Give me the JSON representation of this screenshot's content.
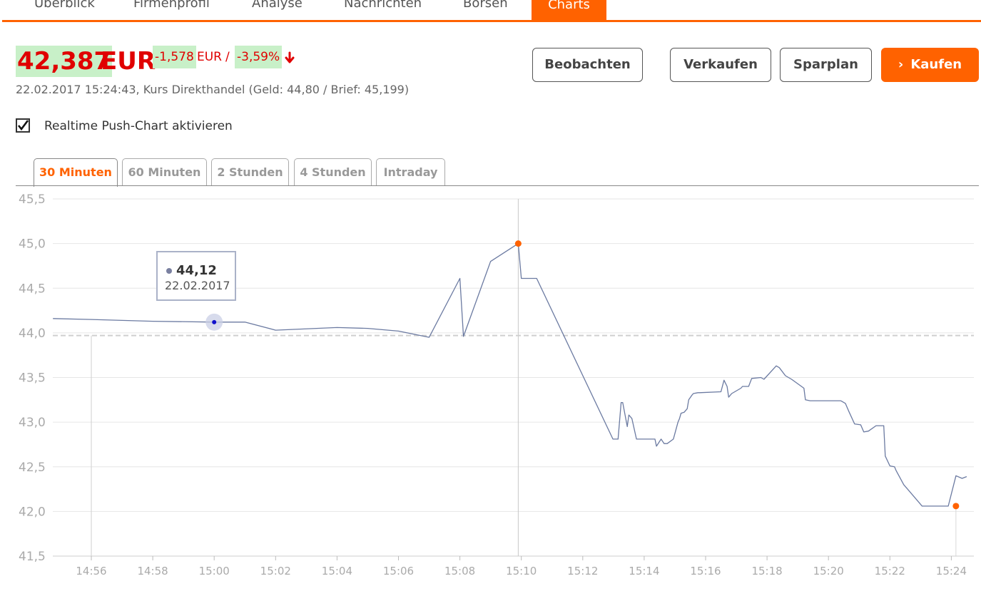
{
  "nav": {
    "items": [
      "Überblick",
      "Firmenprofil",
      "Analyse",
      "Nachrichten",
      "Börsen",
      "Charts"
    ],
    "active": "Charts"
  },
  "quote": {
    "price": "42,387",
    "currency": "EUR",
    "change_abs": "-1,578",
    "change_unit": "EUR",
    "separator": "/",
    "change_pct": "-3,59%",
    "trend_icon": "down-arrow-icon",
    "subline": "22.02.2017 15:24:43, Kurs Direkthandel (Geld: 44,80 / Brief: 45,199)"
  },
  "actions": {
    "watch": "Beobachten",
    "sell": "Verkaufen",
    "savings": "Sparplan",
    "buy": "Kaufen",
    "buy_icon": "chevron-right-icon"
  },
  "realtime": {
    "label": "Realtime Push-Chart aktivieren",
    "checked": true
  },
  "tabs": [
    "30 Minuten",
    "60 Minuten",
    "2 Stunden",
    "4 Stunden",
    "Intraday"
  ],
  "active_tab": "30 Minuten",
  "tooltip": {
    "value": "44,12",
    "date": "22.02.2017"
  },
  "colors": {
    "accent": "#ff6200",
    "negative": "#e00000",
    "highlight": "#c8f0c8",
    "line": "#6b7aa1"
  },
  "chart_data": {
    "type": "line",
    "ylim": [
      41.5,
      45.5
    ],
    "y_ticks": [
      "45,5",
      "45,0",
      "44,5",
      "44,0",
      "43,5",
      "43,0",
      "42,5",
      "42,0",
      "41,5"
    ],
    "x_ticks": [
      "14:56",
      "14:58",
      "15:00",
      "15:02",
      "15:04",
      "15:06",
      "15:08",
      "15:10",
      "15:12",
      "15:14",
      "15:16",
      "15:18",
      "15:20",
      "15:22",
      "15:24"
    ],
    "reference_line": 43.97,
    "grid": true,
    "series": [
      {
        "x": [
          "14:54:45",
          "14:56:00",
          "14:58:00",
          "15:00:00",
          "15:01:00",
          "15:02:00",
          "15:04:00",
          "15:05:00",
          "15:06:00",
          "15:07:00",
          "15:08:00",
          "15:08:07",
          "15:09:00",
          "15:09:54",
          "15:10:00",
          "15:10:30",
          "15:12:59",
          "15:13:09",
          "15:13:15",
          "15:13:18",
          "15:13:27",
          "15:13:30",
          "15:13:36",
          "15:13:45",
          "15:13:51",
          "15:14:21",
          "15:14:24",
          "15:14:33",
          "15:14:39",
          "15:14:42",
          "15:14:45",
          "15:14:57",
          "15:15:06",
          "15:15:09",
          "15:15:12",
          "15:15:18",
          "15:15:24",
          "15:15:27",
          "15:15:33",
          "15:15:36",
          "15:15:45",
          "15:15:48",
          "15:16:30",
          "15:16:36",
          "15:16:42",
          "15:16:45",
          "15:16:51",
          "15:17:03",
          "15:17:09",
          "15:17:12",
          "15:17:24",
          "15:17:30",
          "15:17:48",
          "15:17:54",
          "15:18:18",
          "15:18:24",
          "15:18:36",
          "15:18:48",
          "15:19:12",
          "15:19:15",
          "15:19:24",
          "15:20:24",
          "15:20:33",
          "15:20:39",
          "15:20:51",
          "15:21:03",
          "15:21:09",
          "15:21:18",
          "15:21:33",
          "15:21:48",
          "15:21:51",
          "15:22:00",
          "15:22:09",
          "15:22:12",
          "15:22:27",
          "15:23:03",
          "15:23:09",
          "15:23:42",
          "15:23:54",
          "15:24:09",
          "15:24:21",
          "15:24:30"
        ],
        "values": [
          44.16,
          44.15,
          44.13,
          44.12,
          44.12,
          44.03,
          44.06,
          44.05,
          44.02,
          43.95,
          44.61,
          43.96,
          44.8,
          45.0,
          44.61,
          44.61,
          42.81,
          42.81,
          43.22,
          43.22,
          42.95,
          43.08,
          43.04,
          42.81,
          42.81,
          42.81,
          42.73,
          42.81,
          42.76,
          42.76,
          42.76,
          42.81,
          43.0,
          43.04,
          43.1,
          43.11,
          43.15,
          43.25,
          43.3,
          43.32,
          43.33,
          43.33,
          43.34,
          43.47,
          43.4,
          43.28,
          43.32,
          43.36,
          43.38,
          43.4,
          43.4,
          43.49,
          43.5,
          43.48,
          43.63,
          43.61,
          43.52,
          43.48,
          43.38,
          43.25,
          43.24,
          43.24,
          43.21,
          43.13,
          42.98,
          42.97,
          42.89,
          42.9,
          42.96,
          42.96,
          42.62,
          42.51,
          42.5,
          42.46,
          42.3,
          42.06,
          42.06,
          42.06,
          42.06,
          42.4,
          42.37,
          42.39
        ]
      }
    ],
    "markers": [
      {
        "x": "15:09:54",
        "y": 45.0
      },
      {
        "x": "15:24:09",
        "y": 42.06
      }
    ],
    "focus_point": {
      "x": "15:00:00",
      "y": 44.12
    }
  }
}
